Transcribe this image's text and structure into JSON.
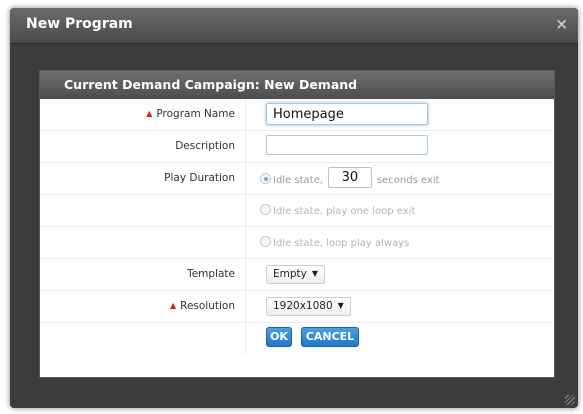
{
  "dialog": {
    "title": "New Program",
    "close_symbol": "×"
  },
  "panel": {
    "title": "Current Demand Campaign: New Demand"
  },
  "form": {
    "required_marker": "▲",
    "program_name": {
      "label": "Program Name",
      "value": "Homepage",
      "required": true
    },
    "description": {
      "label": "Description",
      "value": ""
    },
    "play_duration": {
      "label": "Play Duration",
      "options": [
        {
          "before": "Idle state,",
          "seconds": "30",
          "after": "seconds exit",
          "checked": true
        },
        {
          "text": "Idle state, play one loop exit",
          "checked": false
        },
        {
          "text": "Idle state, loop play always",
          "checked": false
        }
      ]
    },
    "template": {
      "label": "Template",
      "value": "Empty"
    },
    "resolution": {
      "label": "Resolution",
      "value": "1920x1080",
      "required": true
    },
    "caret": "▼"
  },
  "buttons": {
    "ok": "OK",
    "cancel": "CANCEL"
  },
  "colors": {
    "accent_blue": "#2f86d6",
    "required_red": "#d62020",
    "dialog_bg": "#3c3c3c"
  },
  "icons": {
    "close": "close-icon",
    "required": "required-marker-icon",
    "dropdown": "chevron-down-icon",
    "resize": "resize-grip-icon"
  }
}
